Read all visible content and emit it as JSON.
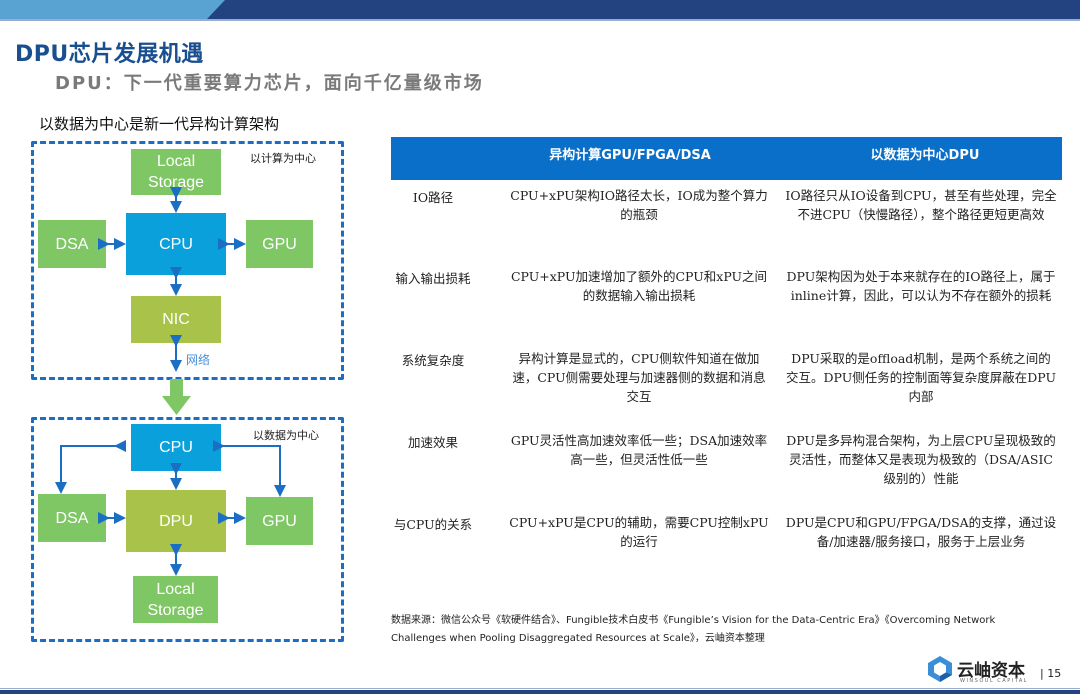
{
  "header": {
    "title": "DPU芯片发展机遇",
    "subtitle": "DPU：下一代重要算力芯片，面向千亿量级市场"
  },
  "diagram": {
    "caption": "以数据为中心是新一代异构计算架构",
    "compute_centric": {
      "label": "以计算为中心",
      "nodes": {
        "storage": "Local Storage",
        "dsa": "DSA",
        "cpu": "CPU",
        "gpu": "GPU",
        "nic": "NIC"
      },
      "network_label": "网络"
    },
    "data_centric": {
      "label": "以数据为中心",
      "nodes": {
        "cpu": "CPU",
        "dsa": "DSA",
        "dpu": "DPU",
        "gpu": "GPU",
        "storage": "Local Storage"
      }
    },
    "colors": {
      "cpu": "#0aa0dc",
      "accelerator": "#7ec764",
      "dpu_nic": "#a8c24a",
      "arrow": "#1a6fc4"
    }
  },
  "table": {
    "headers": [
      "",
      "异构计算GPU/FPGA/DSA",
      "以数据为中心DPU"
    ],
    "rows": [
      {
        "label": "IO路径",
        "hetero": "CPU+xPU架构IO路径太长，IO成为整个算力的瓶颈",
        "dpu": "IO路径只从IO设备到CPU，甚至有些处理，完全不进CPU（快慢路径），整个路径更短更高效"
      },
      {
        "label": "输入输出损耗",
        "hetero": "CPU+xPU加速增加了额外的CPU和xPU之间的数据输入输出损耗",
        "dpu": "DPU架构因为处于本来就存在的IO路径上，属于inline计算，因此，可以认为不存在额外的损耗"
      },
      {
        "label": "系统复杂度",
        "hetero": "异构计算是显式的，CPU侧软件知道在做加速，CPU侧需要处理与加速器侧的数据和消息交互",
        "dpu": "DPU采取的是offload机制，是两个系统之间的交互。DPU侧任务的控制面等复杂度屏蔽在DPU内部"
      },
      {
        "label": "加速效果",
        "hetero": "GPU灵活性高加速效率低一些；DSA加速效率高一些，但灵活性低一些",
        "dpu": "DPU是多异构混合架构，为上层CPU呈现极致的灵活性，而整体又是表现为极致的（DSA/ASIC级别的）性能"
      },
      {
        "label": "与CPU的关系",
        "hetero": "CPU+xPU是CPU的辅助，需要CPU控制xPU的运行",
        "dpu": "DPU是CPU和GPU/FPGA/DSA的支撑，通过设备/加速器/服务接口，服务于上层业务"
      }
    ],
    "header_color": "#0a6fc9"
  },
  "footer": {
    "source": "数据来源：微信公众号《软硬件结合》、Fungible技术白皮书《Fungible’s Vision for the Data-Centric Era》《Overcoming Network Challenges when Pooling Disaggregated Resources at Scale》，云岫资本整理",
    "logo_name": "云岫资本",
    "logo_sub": "WINSOUL CAPITAL",
    "page_number": "| 15"
  }
}
